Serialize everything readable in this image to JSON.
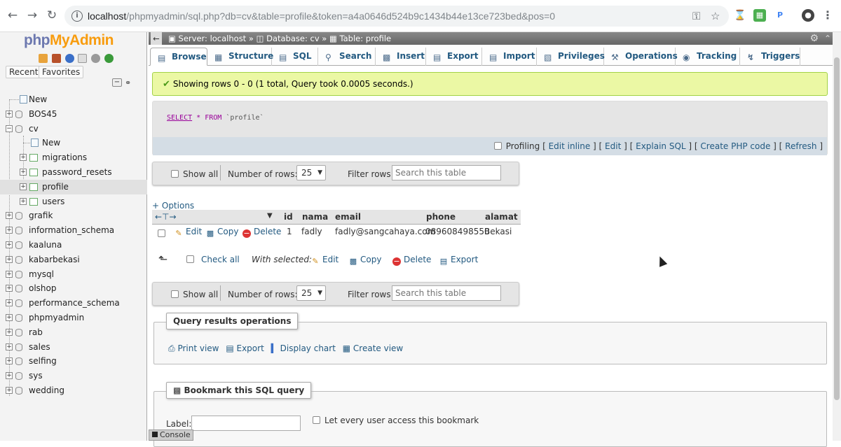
{
  "browser": {
    "url_host": "localhost",
    "url_rest": "/phpmyadmin/sql.php?db=cv&table=profile&token=a4a0646d524b9c1434b44e13ce723bed&pos=0",
    "back_icon": "arrow-left-icon",
    "forward_icon": "arrow-right-icon",
    "reload_icon": "reload-icon",
    "info_icon": "info-icon",
    "key_icon": "key-icon",
    "star_icon": "star-icon",
    "ext_labels": [
      "P"
    ]
  },
  "sidebar": {
    "logo_php": "php",
    "logo_my": "MyAdmin",
    "recent_tab": "Recent",
    "favorites_tab": "Favorites",
    "tree": {
      "new": "New",
      "databases": [
        "BOS45",
        "cv",
        "grafik",
        "information_schema",
        "kaaluna",
        "kabarbekasi",
        "mysql",
        "olshop",
        "performance_schema",
        "phpmyadmin",
        "rab",
        "sales",
        "selfing",
        "sys",
        "wedding"
      ],
      "cv_children": {
        "new": "New",
        "tables": [
          "migrations",
          "password_resets",
          "profile",
          "users"
        ]
      },
      "active_table": "profile"
    }
  },
  "breadcrumb": {
    "server": "Server: localhost",
    "database": "Database: cv",
    "table": "Table: profile",
    "separator": "»"
  },
  "tabs": [
    "Browse",
    "Structure",
    "SQL",
    "Search",
    "Insert",
    "Export",
    "Import",
    "Privileges",
    "Operations",
    "Tracking",
    "Triggers"
  ],
  "active_tab": "Browse",
  "message": {
    "success": "Showing rows 0 - 0 (1 total, Query took 0.0005 seconds.)"
  },
  "sql": {
    "select": "SELECT",
    "star": "*",
    "from": "FROM",
    "table": "`profile`",
    "profiling_label": "Profiling",
    "links": [
      "Edit inline",
      "Edit",
      "Explain SQL",
      "Create PHP code",
      "Refresh"
    ]
  },
  "nav": {
    "show_all": "Show all",
    "rows_label": "Number of rows:",
    "rows_value": "25",
    "filter_label": "Filter rows:",
    "filter_placeholder": "Search this table"
  },
  "options_label": "+ Options",
  "table": {
    "columns": [
      "id",
      "nama",
      "email",
      "phone",
      "alamat"
    ],
    "rows": [
      {
        "id": "1",
        "nama": "fadly",
        "email": "fadly@sangcahaya.com",
        "phone": "089608498550",
        "alamat": "Bekasi"
      }
    ],
    "row_actions": [
      "Edit",
      "Copy",
      "Delete"
    ]
  },
  "with_selected": {
    "check_all": "Check all",
    "label": "With selected:",
    "actions": [
      "Edit",
      "Copy",
      "Delete",
      "Export"
    ]
  },
  "query_ops": {
    "legend": "Query results operations",
    "actions": [
      "Print view",
      "Export",
      "Display chart",
      "Create view"
    ]
  },
  "bookmark": {
    "legend": "Bookmark this SQL query",
    "label": "Label:",
    "every_user": "Let every user access this bookmark"
  },
  "console": "Console"
}
